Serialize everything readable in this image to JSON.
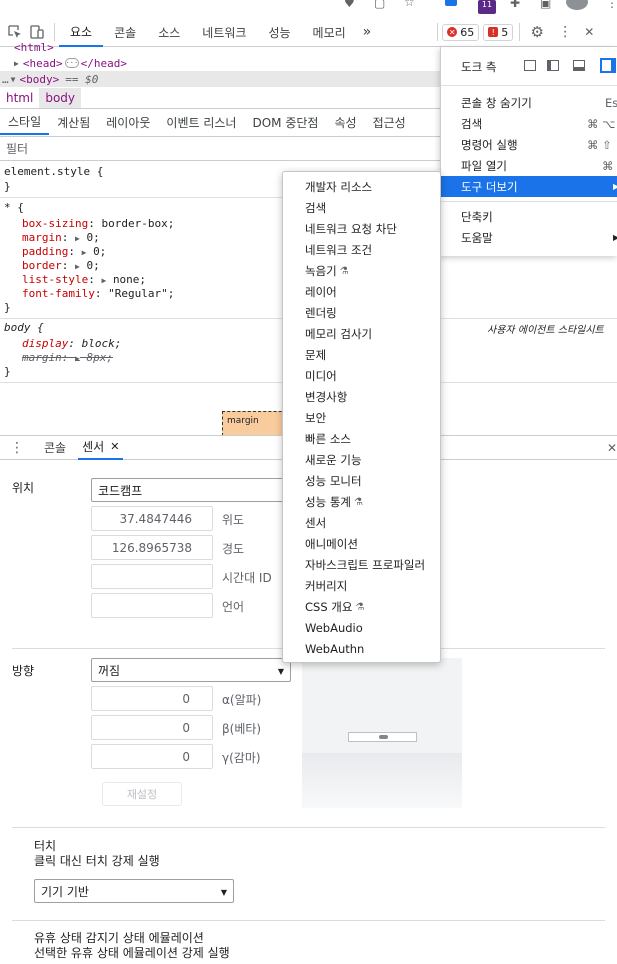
{
  "toolbar": {
    "tabs": [
      "요소",
      "콘솔",
      "소스",
      "네트워크",
      "성능",
      "메모리"
    ],
    "more": "»",
    "errors": "65",
    "warnings": "5"
  },
  "dom": {
    "line0": "<html>",
    "head": "<head>",
    "head_close": "</head>",
    "body": "<body>",
    "body_eq": "== $0"
  },
  "breadcrumb": [
    "html",
    "body"
  ],
  "styles": {
    "subtabs": [
      "스타일",
      "계산됨",
      "레이아웃",
      "이벤트 리스너",
      "DOM 중단점",
      "속성",
      "접근성"
    ],
    "filter_placeholder": "필터",
    "element_style": "element.style {",
    "close": "}",
    "star_selector": "* {",
    "props": [
      {
        "name": "box-sizing",
        "value": "border-box;"
      },
      {
        "name": "margin",
        "value": "0;"
      },
      {
        "name": "padding",
        "value": "0;"
      },
      {
        "name": "border",
        "value": "0;"
      },
      {
        "name": "list-style",
        "value": "none;"
      },
      {
        "name": "font-family",
        "value": "\"Regular\";"
      }
    ],
    "body_selector": "body {",
    "ua_label": "사용자 에이전트 스타일시트",
    "body_props": [
      {
        "name": "display",
        "value": "block;"
      },
      {
        "name": "margin",
        "value": "8px;"
      }
    ],
    "box_label": "margin"
  },
  "drawer": {
    "tabs": [
      "콘솔",
      "센서"
    ]
  },
  "more_tools_menu": [
    "개발자 리소스",
    "검색",
    "네트워크 요청 차단",
    "네트워크 조건",
    "녹음기",
    "레이어",
    "렌더링",
    "메모리 검사기",
    "문제",
    "미디어",
    "변경사항",
    "보안",
    "빠른 소스",
    "새로운 기능",
    "성능 모니터",
    "성능 통계",
    "센서",
    "애니메이션",
    "자바스크립트 프로파일러",
    "커버리지",
    "CSS 개요",
    "WebAudio",
    "WebAuthn"
  ],
  "main_menu": {
    "dock_label": "도크 측",
    "items": [
      {
        "label": "콘솔 창 숨기기",
        "shortcut": "Es"
      },
      {
        "label": "검색",
        "shortcut": "⌘ ⌥"
      },
      {
        "label": "명령어 실행",
        "shortcut": "⌘ ⇧"
      },
      {
        "label": "파일 열기",
        "shortcut": "⌘"
      },
      {
        "label": "도구 더보기",
        "shortcut": ""
      },
      {
        "label": "단축키",
        "shortcut": ""
      },
      {
        "label": "도움말",
        "shortcut": ""
      }
    ]
  },
  "sensors": {
    "location_label": "위치",
    "location_value": "코드캠프",
    "latitude": "37.4847446",
    "latitude_label": "위도",
    "longitude": "126.8965738",
    "longitude_label": "경도",
    "timezone_label": "시간대 ID",
    "locale_label": "언어",
    "orientation_label": "방향",
    "orientation_value": "꺼짐",
    "alpha": "0",
    "alpha_label": "α(알파)",
    "beta": "0",
    "beta_label": "β(베타)",
    "gamma": "0",
    "gamma_label": "γ(감마)",
    "reset": "재설정",
    "touch_title": "터치",
    "touch_desc": "클릭 대신 터치 강제 실행",
    "touch_value": "기기 기반",
    "idle_title": "유휴 상태 감지기 상태 에뮬레이션",
    "idle_desc": "선택한 유휴 상태 에뮬레이션 강제 실행"
  },
  "colors": {
    "accent": "#1a73e8",
    "selected_bg": "#1a73e8",
    "error": "#d93025"
  }
}
